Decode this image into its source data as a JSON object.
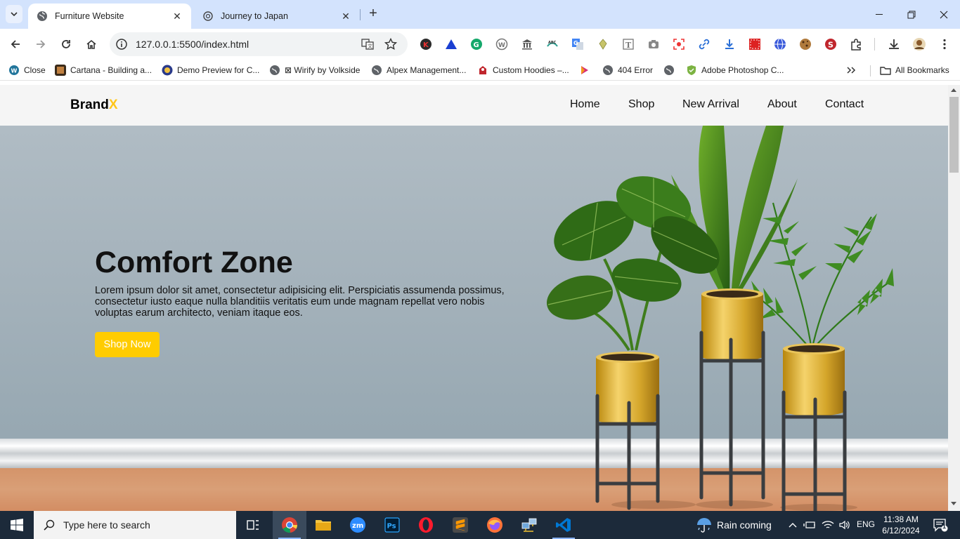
{
  "browser": {
    "tabs": [
      {
        "title": "Furniture Website",
        "active": true
      },
      {
        "title": "Journey to Japan",
        "active": false
      }
    ],
    "url": "127.0.0.1:5500/index.html",
    "bookmarks": [
      "Close",
      "Cartana - Building a...",
      "Demo Preview for C...",
      "⊠ Wirify by Volkside",
      "Alpex Management...",
      "Custom Hoodies –...",
      "404 Error",
      "Adobe Photoshop C..."
    ],
    "all_bookmarks_label": "All Bookmarks",
    "colors": {
      "tab_strip": "#d3e3fd",
      "omnibox": "#f1f3f4"
    }
  },
  "site": {
    "logo_text": "Brand",
    "logo_accent": "X",
    "nav": [
      "Home",
      "Shop",
      "New Arrival",
      "About",
      "Contact"
    ],
    "hero": {
      "title": "Comfort Zone",
      "text": "Lorem ipsum dolor sit amet, consectetur adipisicing elit. Perspiciatis assumenda possimus, consectetur iusto eaque nulla blanditiis veritatis eum unde magnam repellat vero nobis voluptas earum architecto, veniam itaque eos.",
      "button": "Shop Now"
    },
    "colors": {
      "accent": "#ffcc00",
      "hero_wall": "#a3b1ba",
      "floor": "#d4946a"
    }
  },
  "taskbar": {
    "search_placeholder": "Type here to search",
    "weather": "Rain coming",
    "language": "ENG",
    "time": "11:38 AM",
    "date": "6/12/2024",
    "notification_count": "1"
  }
}
